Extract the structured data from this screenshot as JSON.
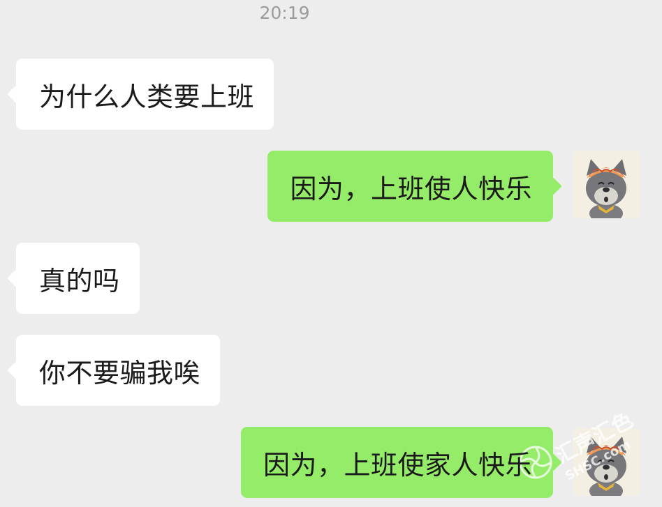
{
  "chat": {
    "timestamp": "20:19",
    "messages": [
      {
        "side": "in",
        "text": "为什么人类要上班"
      },
      {
        "side": "out",
        "text": "因为，上班使人快乐"
      },
      {
        "side": "in",
        "text": "真的吗"
      },
      {
        "side": "in",
        "text": "你不要骗我唉"
      },
      {
        "side": "out",
        "text": "因为，上班使家人快乐"
      }
    ]
  },
  "colors": {
    "background": "#ededed",
    "incoming_bubble": "#ffffff",
    "outgoing_bubble": "#95ec69",
    "timestamp": "#9b9b9b"
  },
  "avatar": {
    "icon": "grey-wolf-avatar-icon"
  },
  "watermark": {
    "text": "汇声汇色",
    "sub": "SHSC.com"
  }
}
